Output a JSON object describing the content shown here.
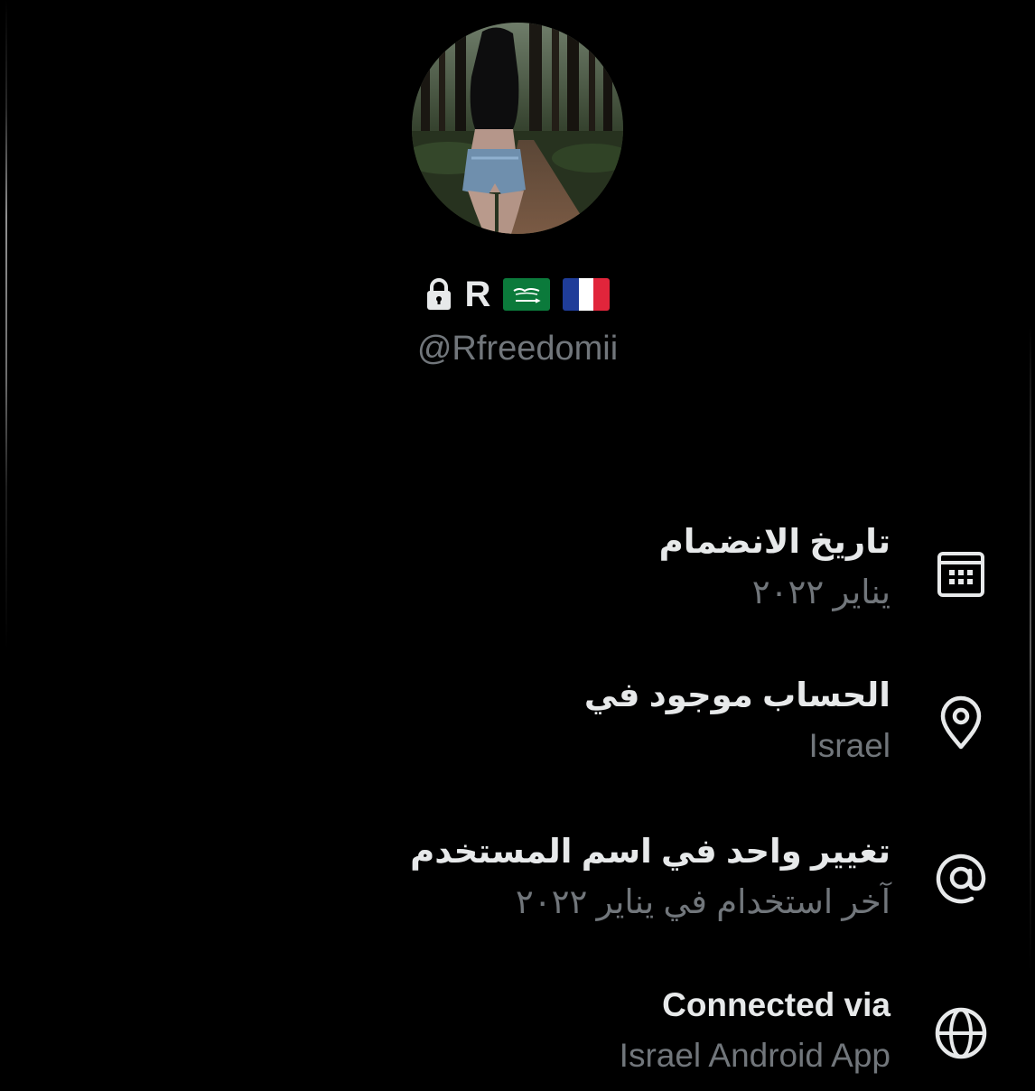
{
  "profile": {
    "display_name": "R",
    "handle": "@Rfreedomii"
  },
  "icons": {
    "lock": "lock-icon",
    "flag_1": "saudi-flag-icon",
    "flag_2": "france-flag-icon",
    "joined": "calendar-icon",
    "location": "location-pin-icon",
    "username": "at-sign-icon",
    "connected": "globe-icon"
  },
  "about": {
    "joined": {
      "title": "تاريخ الانضمام",
      "value": "يناير ٢٠٢٢"
    },
    "location": {
      "title": "الحساب موجود في",
      "value": "Israel"
    },
    "username_changes": {
      "title": "تغيير واحد في اسم المستخدم",
      "value": "آخر استخدام في يناير ٢٠٢٢"
    },
    "connected_via": {
      "title": "Connected via",
      "value": "Israel Android App"
    }
  },
  "colors": {
    "background": "#000000",
    "primary_text": "#e7e9ea",
    "secondary_text": "#71767b"
  }
}
